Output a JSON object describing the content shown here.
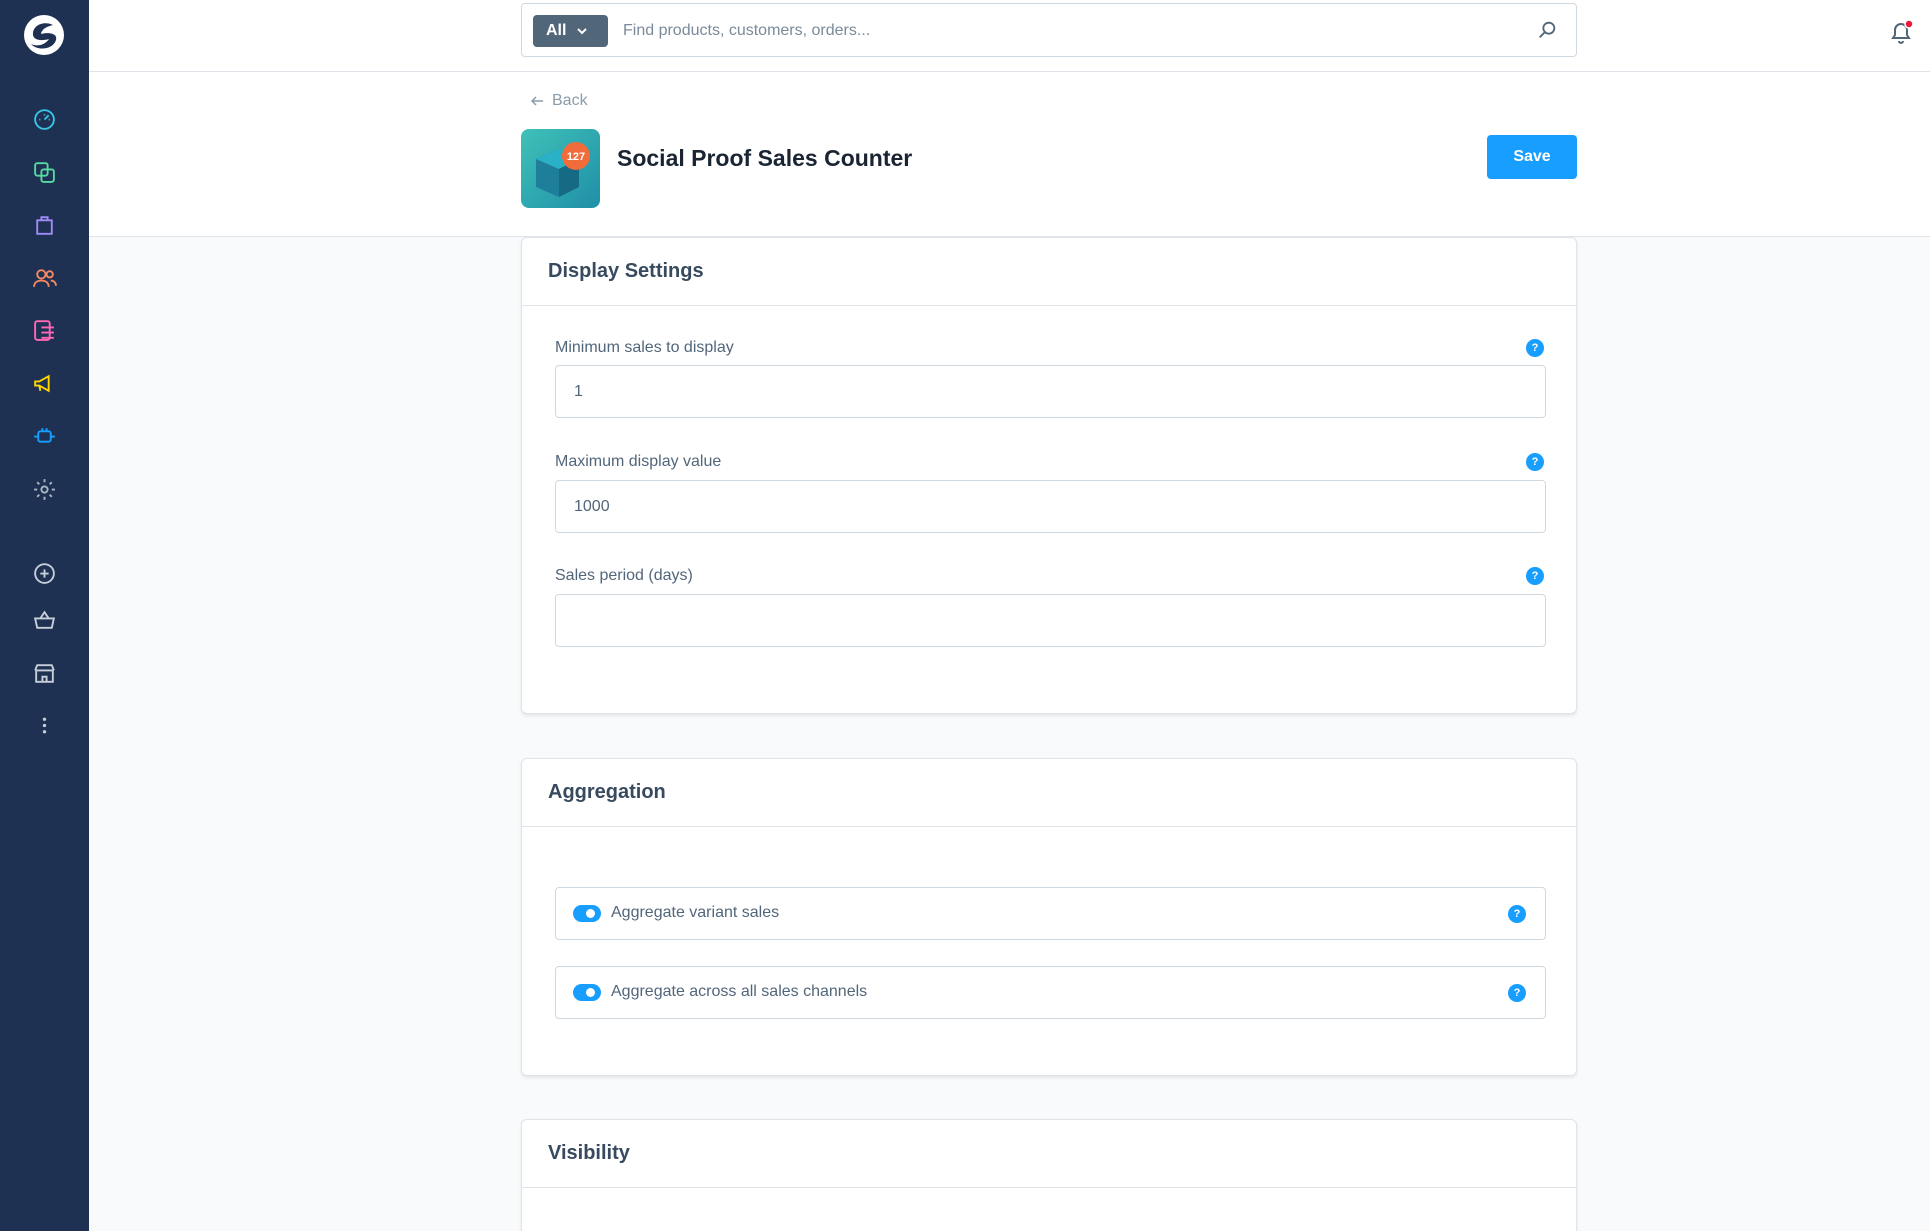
{
  "search": {
    "filter_label": "All",
    "placeholder": "Find products, customers, orders..."
  },
  "header": {
    "back_label": "Back",
    "app_title": "Social Proof Sales Counter",
    "app_icon_badge": "127",
    "save_label": "Save"
  },
  "display_settings": {
    "title": "Display Settings",
    "fields": [
      {
        "label": "Minimum sales to display",
        "value": "1",
        "help": "?"
      },
      {
        "label": "Maximum display value",
        "value": "1000",
        "help": "?"
      },
      {
        "label": "Sales period (days)",
        "value": "",
        "help": "?"
      }
    ]
  },
  "aggregation": {
    "title": "Aggregation",
    "toggles": [
      {
        "label": "Aggregate variant sales",
        "on": true,
        "help": "?"
      },
      {
        "label": "Aggregate across all sales channels",
        "on": true,
        "help": "?"
      }
    ]
  },
  "visibility": {
    "title": "Visibility"
  },
  "colors": {
    "sidebar": "#1f3152",
    "primary": "#189eff",
    "notification_dot": "#e8193c"
  },
  "sidebar": {
    "icons": [
      "dashboard-icon",
      "catalogue-icon",
      "orders-icon",
      "customers-icon",
      "content-icon",
      "marketing-icon",
      "extensions-icon",
      "settings-icon",
      "add-icon",
      "basket-icon",
      "storefront-icon",
      "more-icon"
    ]
  }
}
